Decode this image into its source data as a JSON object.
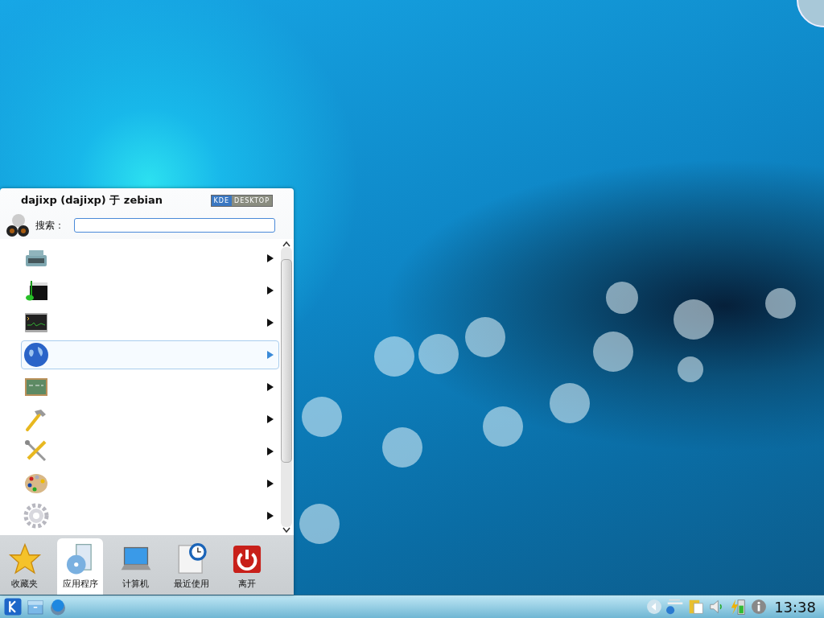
{
  "launcher": {
    "user": "dajixp (dajixp) 于 zebian",
    "logo": [
      "KDE",
      "DESKTOP"
    ],
    "search": {
      "label": "搜索："
    },
    "items": [
      {
        "kind": "typewriter",
        "selected": false
      },
      {
        "kind": "multimedia",
        "selected": false
      },
      {
        "kind": "monitor",
        "selected": false
      },
      {
        "kind": "globe",
        "selected": true
      },
      {
        "kind": "chalkboard",
        "selected": false
      },
      {
        "kind": "hammer",
        "selected": false
      },
      {
        "kind": "tools",
        "selected": false
      },
      {
        "kind": "palette",
        "selected": false
      },
      {
        "kind": "gear",
        "selected": false
      }
    ],
    "tabs": [
      {
        "label": "收藏夹",
        "kind": "star",
        "selected": false
      },
      {
        "label": "应用程序",
        "kind": "disc",
        "selected": true
      },
      {
        "label": "计算机",
        "kind": "laptop",
        "selected": false
      },
      {
        "label": "最近使用",
        "kind": "clock",
        "selected": false
      },
      {
        "label": "离开",
        "kind": "power",
        "selected": false
      }
    ]
  },
  "taskbar": {
    "launchers": [
      {
        "kind": "kde"
      },
      {
        "kind": "drawer"
      },
      {
        "kind": "globe"
      }
    ],
    "tray": [
      {
        "kind": "arrow"
      },
      {
        "kind": "network"
      },
      {
        "kind": "clipboard"
      },
      {
        "kind": "speaker"
      },
      {
        "kind": "battery"
      },
      {
        "kind": "info"
      }
    ],
    "clock": "13:38"
  }
}
